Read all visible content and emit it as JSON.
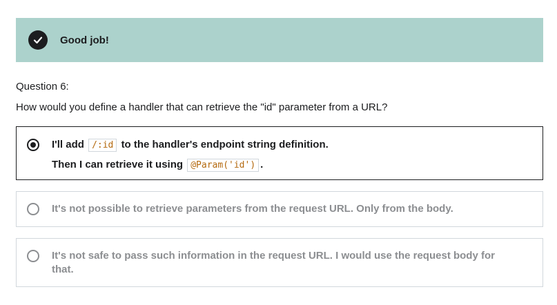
{
  "feedback": {
    "title": "Good job!",
    "icon": "check-circle-icon",
    "background": "#acd2cc"
  },
  "question": {
    "number_label": "Question 6:",
    "text": "How would you define a handler that can retrieve the \"id\" parameter from a URL?"
  },
  "options": [
    {
      "selected": true,
      "line1_before": "I'll add",
      "line1_code": "/:id",
      "line1_after": "to the handler's endpoint string definition.",
      "line2_before": "Then I can retrieve it using",
      "line2_code": "@Param('id')",
      "line2_after": "."
    },
    {
      "selected": false,
      "text": "It's not possible to retrieve parameters from the request URL. Only from the body."
    },
    {
      "selected": false,
      "text_line1": "It's not safe to pass such information in the request URL. I would use the request body for",
      "text_line2": "that."
    }
  ]
}
